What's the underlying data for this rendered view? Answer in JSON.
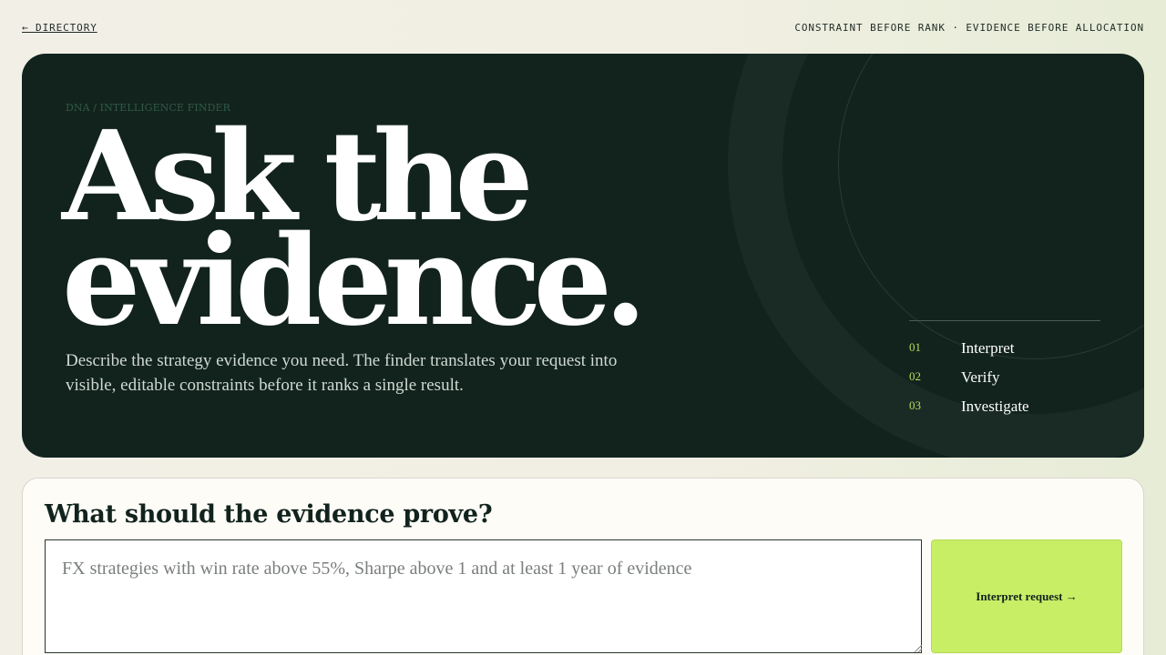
{
  "nav": {
    "back_label": "← DIRECTORY",
    "tagline": "CONSTRAINT BEFORE RANK · EVIDENCE BEFORE ALLOCATION"
  },
  "hero": {
    "eyebrow": "DNA / INTELLIGENCE FINDER",
    "headline_line1": "Ask the",
    "headline_line2": "evidence.",
    "description": "Describe the strategy evidence you need. The finder translates your request into visible, editable constraints before it ranks a single result.",
    "steps": [
      {
        "num": "01",
        "label": "Interpret"
      },
      {
        "num": "02",
        "label": "Verify"
      },
      {
        "num": "03",
        "label": "Investigate"
      }
    ]
  },
  "query": {
    "title": "What should the evidence prove?",
    "placeholder": "FX strategies with win rate above 55%, Sharpe above 1 and at least 1 year of evidence",
    "button_label": "Interpret request →"
  },
  "colors": {
    "hero_bg": "#12231e",
    "accent_lime": "#c8ee66",
    "step_number": "#b6dd5a",
    "page_bg": "#f2efe6"
  }
}
